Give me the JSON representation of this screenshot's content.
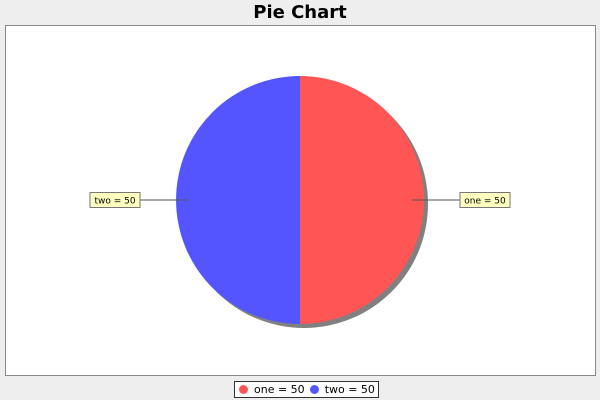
{
  "chart_data": {
    "type": "pie",
    "title": "Pie Chart",
    "slices": [
      {
        "name": "one",
        "value": 50,
        "color": "#ff5555",
        "label": "one = 50"
      },
      {
        "name": "two",
        "value": 50,
        "color": "#5555ff",
        "label": "two = 50"
      }
    ],
    "legend": {
      "position": "bottom",
      "items": [
        {
          "label": "one = 50",
          "color": "#ff5555"
        },
        {
          "label": "two = 50",
          "color": "#5555ff"
        }
      ]
    }
  }
}
